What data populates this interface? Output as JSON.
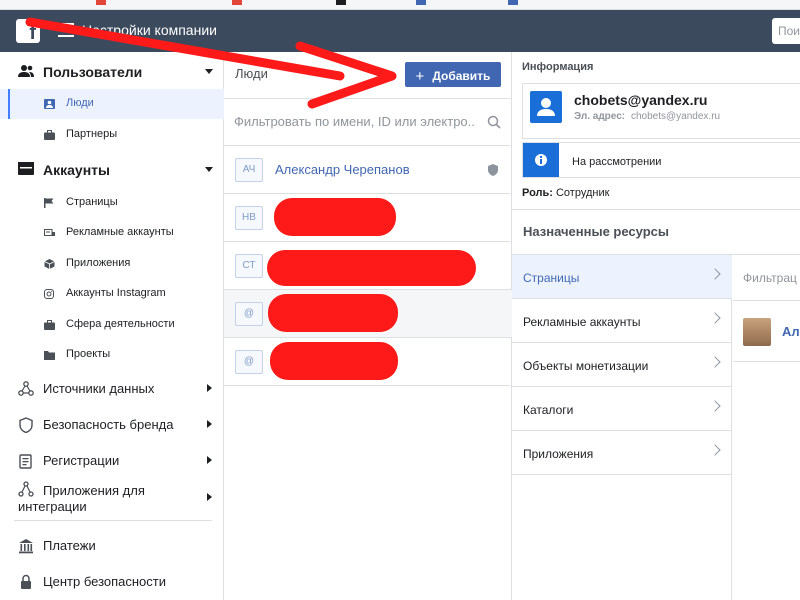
{
  "header": {
    "logo_letter": "f",
    "title": "Настройки компании",
    "search_placeholder": "Поиск"
  },
  "sidebar": {
    "users_section": {
      "label": "Пользователи",
      "items": [
        {
          "label": "Люди",
          "icon": "person-icon"
        },
        {
          "label": "Партнеры",
          "icon": "briefcase-icon"
        }
      ]
    },
    "accounts_section": {
      "label": "Аккаунты",
      "items": [
        {
          "label": "Страницы",
          "icon": "flag-icon"
        },
        {
          "label": "Рекламные аккаунты",
          "icon": "ad-account-icon"
        },
        {
          "label": "Приложения",
          "icon": "cube-icon"
        },
        {
          "label": "Аккаунты Instagram",
          "icon": "instagram-icon"
        },
        {
          "label": "Сфера деятельности",
          "icon": "briefcase-icon"
        },
        {
          "label": "Проекты",
          "icon": "folder-icon"
        }
      ]
    },
    "nav": [
      {
        "label": "Источники данных",
        "icon": "data-sources-icon"
      },
      {
        "label": "Безопасность бренда",
        "icon": "shield-icon"
      },
      {
        "label": "Регистрации",
        "icon": "registration-icon"
      },
      {
        "label": "Приложения для интеграции",
        "icon": "integration-icon"
      }
    ],
    "bottom": [
      {
        "label": "Платежи",
        "icon": "bank-icon"
      },
      {
        "label": "Центр безопасности",
        "icon": "lock-icon"
      }
    ]
  },
  "people": {
    "title": "Люди",
    "add_button": "Добавить",
    "filter_placeholder": "Фильтровать по имени, ID или электро...",
    "list": [
      {
        "initials": "АЧ",
        "name": "Александр Черепанов"
      },
      {
        "initials": "НВ",
        "name": ""
      },
      {
        "initials": "СТ",
        "name": ""
      },
      {
        "initials": "@",
        "name": ""
      },
      {
        "initials": "@",
        "name": ""
      }
    ]
  },
  "info": {
    "heading": "Информация",
    "email_big": "chobets@yandex.ru",
    "email_label": "Эл. адрес:",
    "email_small": "chobets@yandex.ru",
    "status": "На рассмотрении",
    "role_label": "Роль:",
    "role_value": "Сотрудник",
    "assigned_title": "Назначенные ресурсы",
    "resources": [
      {
        "label": "Страницы"
      },
      {
        "label": "Рекламные аккаунты"
      },
      {
        "label": "Объекты монетизации"
      },
      {
        "label": "Каталоги"
      },
      {
        "label": "Приложения"
      }
    ],
    "right_filter": "Фильтрац",
    "right_person": "Ал"
  },
  "colors": {
    "header_bg": "#3b4a5d",
    "accent": "#4267b2",
    "info_blue": "#1a6ed8",
    "annotation_red": "#ff1a1a"
  }
}
